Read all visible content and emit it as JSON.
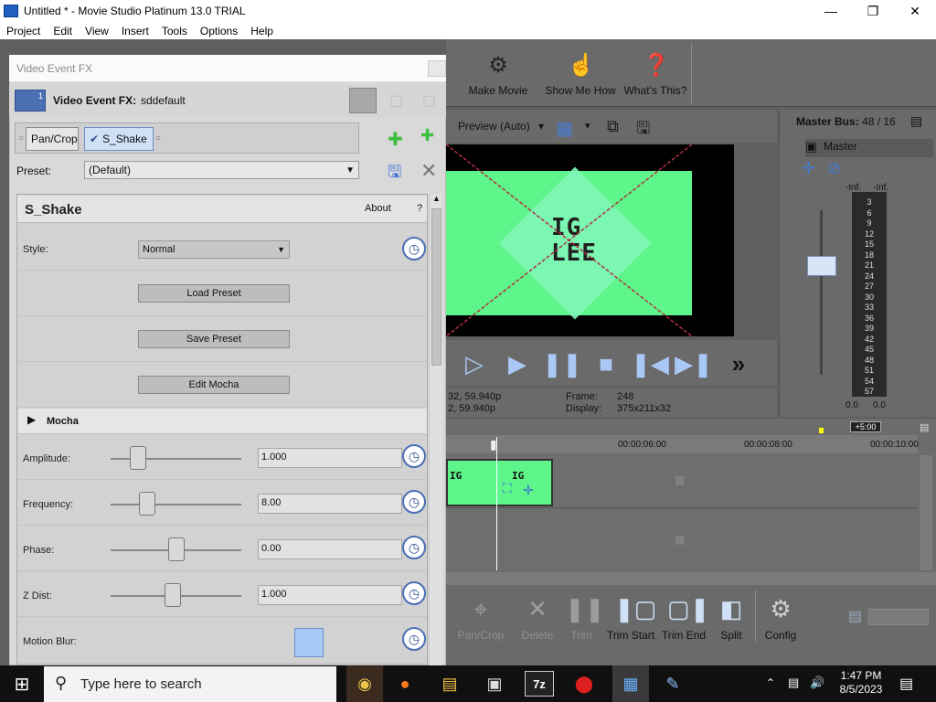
{
  "window": {
    "title": "Untitled * - Movie Studio Platinum 13.0 TRIAL",
    "minimize_icon": "minimize-icon",
    "maximize_icon": "restore-icon",
    "close_icon": "close-icon"
  },
  "menu": [
    "Project",
    "Edit",
    "View",
    "Insert",
    "Tools",
    "Options",
    "Help"
  ],
  "toolbar": {
    "make_movie": "Make Movie",
    "show_me_how": "Show Me How",
    "whats_this": "What's This?"
  },
  "preview": {
    "mode": "Preview (Auto)",
    "logo_line1": "IG",
    "logo_line2": "LEE",
    "project_info_1": "32, 59.940p",
    "project_info_2": "2, 59.940p",
    "frame_label": "Frame:",
    "frame_value": "248",
    "display_label": "Display:",
    "display_value": "375x211x32"
  },
  "master": {
    "title": "Master Bus:",
    "title_value": "48 / 16",
    "label": "Master",
    "inf_left": "-Inf.",
    "inf_right": "-Inf.",
    "scale": [
      "3",
      "6",
      "9",
      "12",
      "15",
      "18",
      "21",
      "24",
      "27",
      "30",
      "33",
      "36",
      "39",
      "42",
      "45",
      "48",
      "51",
      "54",
      "57"
    ],
    "bottom_left": "0.0",
    "bottom_right": "0.0"
  },
  "timeline": {
    "marker_label": "+5:00",
    "ruler": [
      "00:00:06:00",
      "00:00:08:00",
      "00:00:10:00"
    ],
    "clip_logo": "IG"
  },
  "editbar": {
    "pan_crop": "Pan/Crop",
    "delete": "Delete",
    "trim": "Trim",
    "trim_start": "Trim Start",
    "trim_end": "Trim End",
    "split": "Split",
    "config": "Config"
  },
  "fx": {
    "window_title": "Video Event FX",
    "header_label": "Video Event FX:",
    "header_value": "sddefault",
    "badge": "1",
    "chain": [
      "Pan/Crop",
      "S_Shake"
    ],
    "preset_label": "Preset:",
    "preset_value": "(Default)",
    "plugin_name": "S_Shake",
    "about": "About",
    "help": "?",
    "style_label": "Style:",
    "style_value": "Normal",
    "load_preset": "Load Preset",
    "save_preset": "Save Preset",
    "edit_mocha": "Edit Mocha",
    "mocha_section": "Mocha",
    "params": [
      {
        "label": "Amplitude:",
        "value": "1.000",
        "level": 0.17
      },
      {
        "label": "Frequency:",
        "value": "8.00",
        "level": 0.25
      },
      {
        "label": "Phase:",
        "value": "0.00",
        "level": 0.5
      },
      {
        "label": "Z Dist:",
        "value": "1.000",
        "level": 0.47
      }
    ],
    "motion_blur_label": "Motion Blur:"
  },
  "taskbar": {
    "search_placeholder": "Type here to search",
    "time": "1:47 PM",
    "date": "8/5/2023",
    "sevenzip": "7z"
  }
}
